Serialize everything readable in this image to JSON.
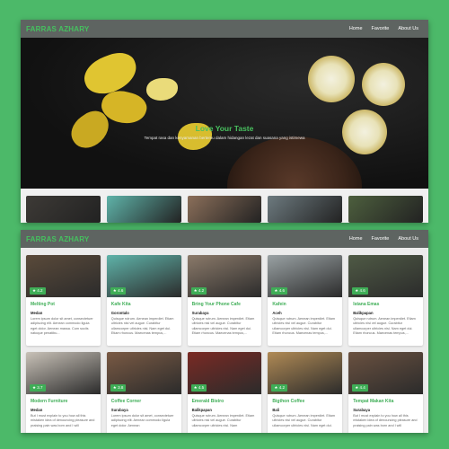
{
  "brand": "FARRAS AZHARY",
  "nav": [
    "Home",
    "Favorite",
    "About Us"
  ],
  "hero": {
    "title": "Love Your Taste",
    "subtitle": "Tempat rasa dan kenyamanan bertemu dalam hidangan lezat dan suasana yang istimewa"
  },
  "strip_colors": [
    "#3d3a36",
    "#5fb3a9",
    "#8b6f5a",
    "#6d7a7f",
    "#4d5f3e"
  ],
  "cards": [
    {
      "title": "Melting Pot",
      "city": "Medan",
      "rating": "4.2",
      "desc": "Lorem ipsum dolor sit amet, consectetuer adipiscing elit. Aenean commodo ligula eget dolor. Aenean massa. Cum sociis natoque penatibu...",
      "img": "#5a4a3a"
    },
    {
      "title": "Kafe Kita",
      "city": "Gorontalo",
      "rating": "4.6",
      "desc": "Quisque rutrum. Aenean imperdiet. Etiam ultricies nisi vel augue. Curabitur ullamcorper ultricies nisi. Nam eget dui. Etiam rhoncus. Maecenas tempus,...",
      "img": "#5fb3a9"
    },
    {
      "title": "Bring Your Phone Cafe",
      "city": "Surabaya",
      "rating": "4.2",
      "desc": "Quisque rutrum. Aenean imperdiet. Etiam ultricies nisi vel augue. Curabitur ullamcorper ultricies nisi. Nam eget dui. Etiam rhoncus. Maecenas tempus,...",
      "img": "#8b7a6a"
    },
    {
      "title": "Kafein",
      "city": "Aceh",
      "rating": "4.6",
      "desc": "Quisque rutrum. Aenean imperdiet. Etiam ultricies nisi vel augue. Curabitur ullamcorper ultricies nisi. Nam eget dui. Etiam rhoncus. Maecenas tempus,...",
      "img": "#9aa2a4"
    },
    {
      "title": "Istana Emas",
      "city": "Balikpapan",
      "rating": "4.6",
      "desc": "Quisque rutrum. Aenean imperdiet. Etiam ultricies nisi vel augue. Curabitur ullamcorper ultricies nisi. Nam eget dui. Etiam rhoncus. Maecenas tempus,...",
      "img": "#4f5a45"
    },
    {
      "title": "Modern Furniture",
      "city": "Medan",
      "rating": "3.7",
      "desc": "But I must explain to you how all this mistaken idea of denouncing pleasure and praising pain was born and I will",
      "img": "#c9c2b8"
    },
    {
      "title": "Coffee Corner",
      "city": "Surabaya",
      "rating": "3.8",
      "desc": "Lorem ipsum dolor sit amet, consectetuer adipiscing elit. Aenean commodo ligula eget dolor. Aenean",
      "img": "#7a5a44"
    },
    {
      "title": "Emerald Bistro",
      "city": "Balikpapan",
      "rating": "4.5",
      "desc": "Quisque rutrum. Aenean imperdiet. Etiam ultricies nisi vel augue. Curabitur ullamcorper ultricies nisi. Nam",
      "img": "#7a2a24"
    },
    {
      "title": "Bigthon Coffee",
      "city": "Bali",
      "rating": "4.2",
      "desc": "Quisque rutrum. Aenean imperdiet. Etiam ultricies nisi vel augue. Curabitur ullamcorper ultricies nisi. Nam eget dui.",
      "img": "#b08a55"
    },
    {
      "title": "Tempat Makan Kita",
      "city": "Surabaya",
      "rating": "4.4",
      "desc": "But I must explain to you how all this mistaken idea of denouncing pleasure and praising pain was born and I will",
      "img": "#6a5140"
    }
  ]
}
